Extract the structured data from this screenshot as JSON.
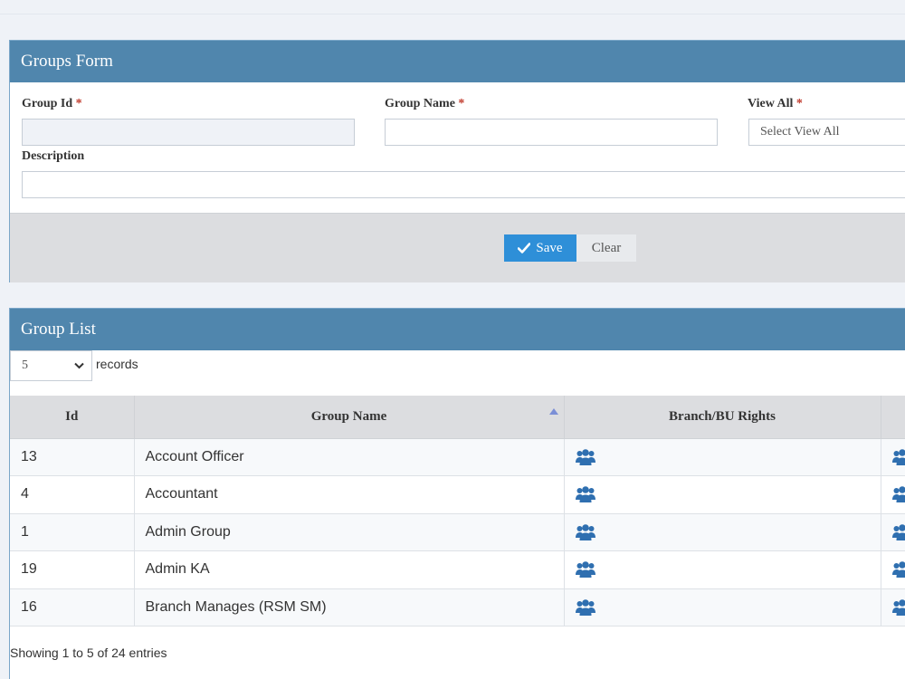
{
  "form": {
    "title": "Groups Form",
    "group_id_label": "Group Id",
    "group_name_label": "Group Name",
    "view_all_label": "View All",
    "required_mark": "*",
    "view_all_placeholder": "Select View All",
    "description_label": "Description",
    "save_label": "Save",
    "clear_label": "Clear"
  },
  "list": {
    "title": "Group List",
    "page_size": "5",
    "records_label": "records",
    "columns": [
      "Id",
      "Group Name",
      "Branch/BU Rights"
    ],
    "rows": [
      {
        "id": "13",
        "name": "Account Officer"
      },
      {
        "id": "4",
        "name": "Accountant"
      },
      {
        "id": "1",
        "name": "Admin Group"
      },
      {
        "id": "19",
        "name": "Admin KA"
      },
      {
        "id": "16",
        "name": "Branch Manages (RSM SM)"
      }
    ],
    "showing_text": "Showing 1 to 5 of 24 entries"
  },
  "icons": {
    "rights": "users-icon",
    "save": "check-icon",
    "dropdown": "chevron-down-icon",
    "sort": "sort-asc-icon"
  },
  "colors": {
    "header": "#5086ad",
    "primary": "#2e8fd8",
    "icon": "#2f6fb0",
    "required": "#c0392b"
  }
}
